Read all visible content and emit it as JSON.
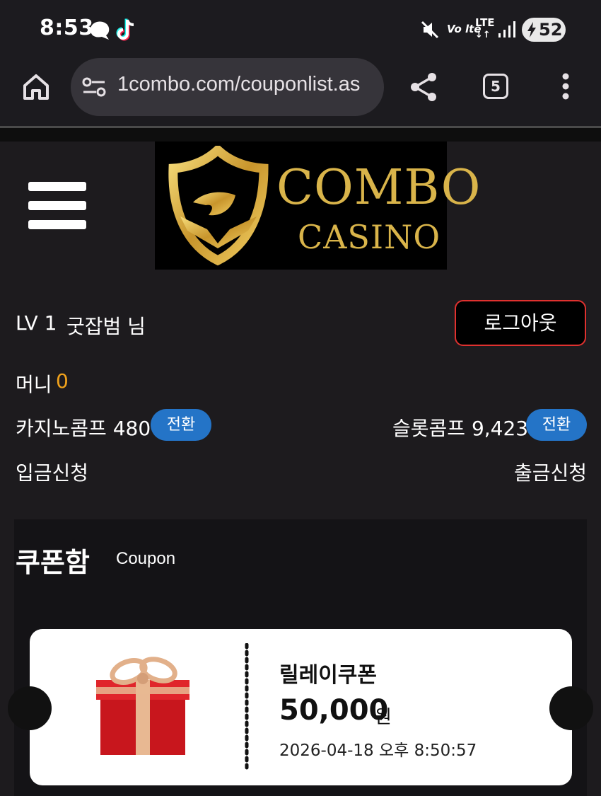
{
  "status_bar": {
    "time": "8:53",
    "network_label": "LTE",
    "volte_label": "Vo lte",
    "battery_level": "52",
    "icons": [
      "thread-icon",
      "tiktok-icon",
      "mute-icon",
      "volte-icon",
      "lte-icon",
      "signal-icon",
      "battery-charging-icon"
    ]
  },
  "browser": {
    "url": "1combo.com/couponlist.as",
    "tab_count": "5",
    "icons": [
      "home-icon",
      "site-settings-icon",
      "share-icon",
      "tabs-icon",
      "more-vert-icon"
    ]
  },
  "header": {
    "logo_line1": "COMBO",
    "logo_line2": "CASINO",
    "logo_color": "#d9b44a"
  },
  "user": {
    "level": "LV 1",
    "name": "굿잡범 님",
    "logout_label": "로그아웃",
    "money_label": "머니",
    "money_value": "0",
    "money_color": "#f0a21c",
    "casino_comp_label": "카지노콤프 480",
    "slot_comp_label": "슬롯콤프 9,423",
    "convert_label": "전환",
    "deposit_label": "입금신청",
    "withdraw_label": "출금신청"
  },
  "coupon_section": {
    "title": "쿠폰함",
    "subtitle": "Coupon",
    "coupons": [
      {
        "name": "릴레이쿠폰",
        "amount": "50,000",
        "unit": "원",
        "date": "2026-04-18 오후 8:50:57",
        "image_icon": "gift-box-icon"
      }
    ]
  }
}
